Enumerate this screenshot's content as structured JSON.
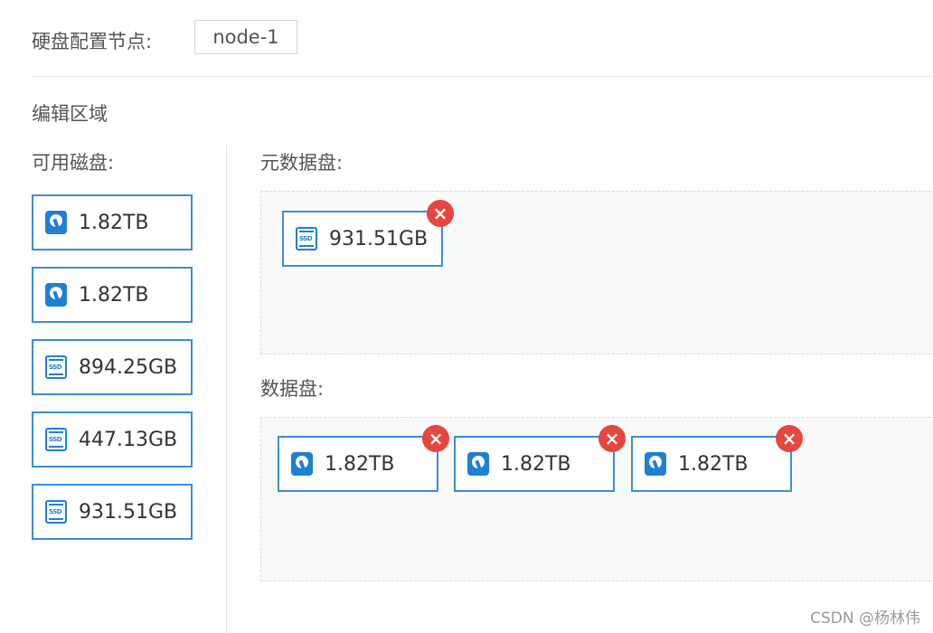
{
  "header": {
    "label": "硬盘配置节点:",
    "node_value": "node-1"
  },
  "edit_area": {
    "title": "编辑区域"
  },
  "available": {
    "title": "可用磁盘:",
    "disks": [
      {
        "type": "hdd",
        "capacity": "1.82TB",
        "icon": "hdd-icon"
      },
      {
        "type": "hdd",
        "capacity": "1.82TB",
        "icon": "hdd-icon"
      },
      {
        "type": "ssd",
        "capacity": "894.25GB",
        "icon": "ssd-icon",
        "icon_text": "SSD"
      },
      {
        "type": "ssd",
        "capacity": "447.13GB",
        "icon": "ssd-icon",
        "icon_text": "SSD"
      },
      {
        "type": "ssd",
        "capacity": "931.51GB",
        "icon": "ssd-icon",
        "icon_text": "SSD"
      }
    ]
  },
  "metadata_disks": {
    "title": "元数据盘:",
    "disks": [
      {
        "type": "ssd",
        "capacity": "931.51GB",
        "icon": "ssd-icon",
        "icon_text": "SSD",
        "remove_icon": "close-icon"
      }
    ]
  },
  "data_disks": {
    "title": "数据盘:",
    "disks": [
      {
        "type": "hdd",
        "capacity": "1.82TB",
        "icon": "hdd-icon",
        "remove_icon": "close-icon"
      },
      {
        "type": "hdd",
        "capacity": "1.82TB",
        "icon": "hdd-icon",
        "remove_icon": "close-icon"
      },
      {
        "type": "hdd",
        "capacity": "1.82TB",
        "icon": "hdd-icon",
        "remove_icon": "close-icon"
      }
    ]
  },
  "watermark": "CSDN @杨林伟",
  "colors": {
    "accent": "#3b8ed8",
    "remove": "#e64540"
  }
}
